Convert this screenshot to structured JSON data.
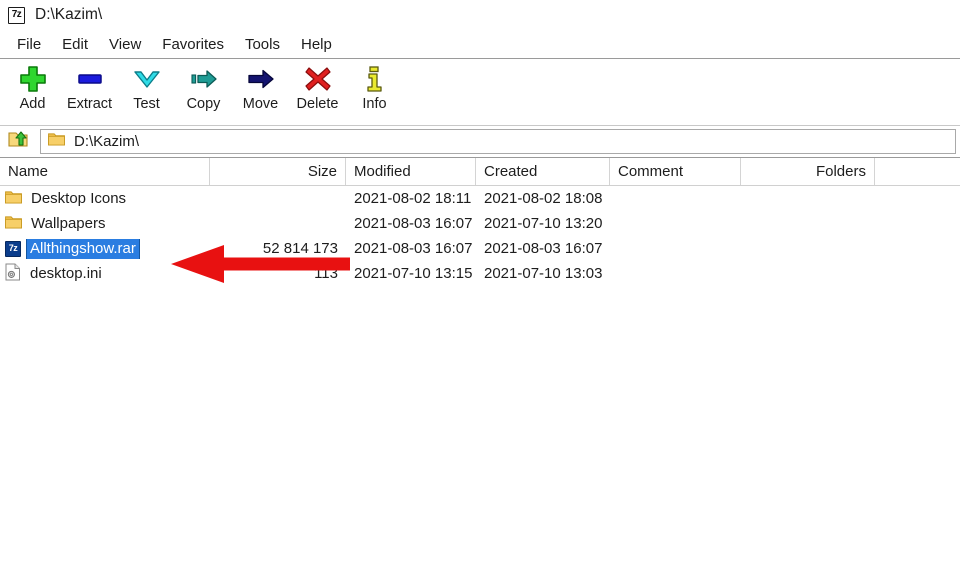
{
  "window": {
    "title": "D:\\Kazim\\",
    "app_icon": "sevenzip-icon",
    "icon_label": "7z"
  },
  "menu": {
    "items": [
      {
        "label": "File",
        "name": "menu-file"
      },
      {
        "label": "Edit",
        "name": "menu-edit"
      },
      {
        "label": "View",
        "name": "menu-view"
      },
      {
        "label": "Favorites",
        "name": "menu-favorites"
      },
      {
        "label": "Tools",
        "name": "menu-tools"
      },
      {
        "label": "Help",
        "name": "menu-help"
      }
    ]
  },
  "toolbar": {
    "buttons": [
      {
        "label": "Add",
        "icon": "plus-icon",
        "color": "#2fbf2f"
      },
      {
        "label": "Extract",
        "icon": "extract-bar-icon",
        "color": "#1a1ae0"
      },
      {
        "label": "Test",
        "icon": "chevron-down-icon",
        "color": "#12c8d8"
      },
      {
        "label": "Copy",
        "icon": "copy-arrow-icon",
        "color": "#137a78"
      },
      {
        "label": "Move",
        "icon": "move-arrow-icon",
        "color": "#0d0d6b"
      },
      {
        "label": "Delete",
        "icon": "red-x-icon",
        "color": "#d41717"
      },
      {
        "label": "Info",
        "icon": "info-i-icon",
        "color": "#e8e832"
      }
    ]
  },
  "address_bar": {
    "up_icon": "folder-up-icon",
    "folder_icon": "folder-icon",
    "path": "D:\\Kazim\\"
  },
  "list": {
    "columns": [
      {
        "label": "Name",
        "align": "left"
      },
      {
        "label": "Size",
        "align": "right"
      },
      {
        "label": "Modified",
        "align": "left"
      },
      {
        "label": "Created",
        "align": "left"
      },
      {
        "label": "Comment",
        "align": "left"
      },
      {
        "label": "Folders",
        "align": "right"
      }
    ],
    "rows": [
      {
        "icon": "folder-icon",
        "name": "Desktop Icons",
        "size": "",
        "modified": "2021-08-02 18:11",
        "created": "2021-08-02 18:08",
        "comment": "",
        "folders": "",
        "selected": false
      },
      {
        "icon": "folder-icon",
        "name": "Wallpapers",
        "size": "",
        "modified": "2021-08-03 16:07",
        "created": "2021-07-10 13:20",
        "comment": "",
        "folders": "",
        "selected": false
      },
      {
        "icon": "sevenzip-file-icon",
        "name": "Allthingshow.rar",
        "size": "52 814 173",
        "modified": "2021-08-03 16:07",
        "created": "2021-08-03 16:07",
        "comment": "",
        "folders": "",
        "selected": true
      },
      {
        "icon": "ini-file-icon",
        "name": "desktop.ini",
        "size": "113",
        "modified": "2021-07-10 13:15",
        "created": "2021-07-10 13:03",
        "comment": "",
        "folders": "",
        "selected": false
      }
    ]
  },
  "annotation": {
    "type": "arrow",
    "direction": "left",
    "color": "#e81111",
    "target": "Allthingshow.rar"
  },
  "colors": {
    "selection": "#2a7de1",
    "annotation": "#e81111",
    "folder": "#f4c64a"
  }
}
